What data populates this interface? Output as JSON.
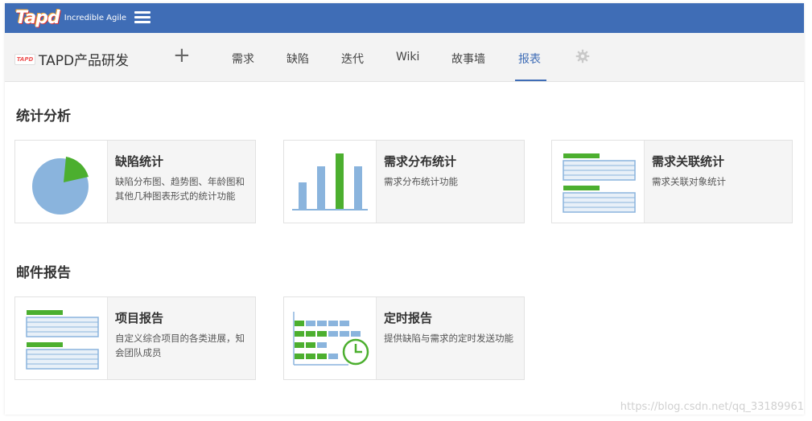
{
  "colors": {
    "brand": "#3f6db6",
    "accent_green": "#4caf2f",
    "chart_blue": "#8ab4dd"
  },
  "topbar": {
    "logo_text": "Tapd",
    "logo_tagline": "Incredible Agile",
    "menu_icon": "hamburger-icon"
  },
  "navbar": {
    "project_logo_text": "TAPD",
    "project_name": "TAPD产品研发",
    "add_icon": "plus-icon",
    "settings_icon": "gear-icon",
    "items": [
      {
        "label": "需求",
        "active": false
      },
      {
        "label": "缺陷",
        "active": false
      },
      {
        "label": "迭代",
        "active": false
      },
      {
        "label": "Wiki",
        "active": false
      },
      {
        "label": "故事墙",
        "active": false
      },
      {
        "label": "报表",
        "active": true
      }
    ]
  },
  "sections": [
    {
      "title": "统计分析",
      "cards": [
        {
          "title": "缺陷统计",
          "desc": "缺陷分布图、趋势图、年龄图和其他几种图表形式的统计功能",
          "icon": "pie-chart-icon"
        },
        {
          "title": "需求分布统计",
          "desc": "需求分布统计功能",
          "icon": "bar-chart-icon"
        },
        {
          "title": "需求关联统计",
          "desc": "需求关联对象统计",
          "icon": "linked-table-icon"
        }
      ]
    },
    {
      "title": "邮件报告",
      "cards": [
        {
          "title": "项目报告",
          "desc": "自定义综合项目的各类进展，知会团队成员",
          "icon": "report-table-icon"
        },
        {
          "title": "定时报告",
          "desc": "提供缺陷与需求的定时发送功能",
          "icon": "scheduled-report-icon"
        }
      ]
    }
  ],
  "watermark": "https://blog.csdn.net/qq_33189961"
}
